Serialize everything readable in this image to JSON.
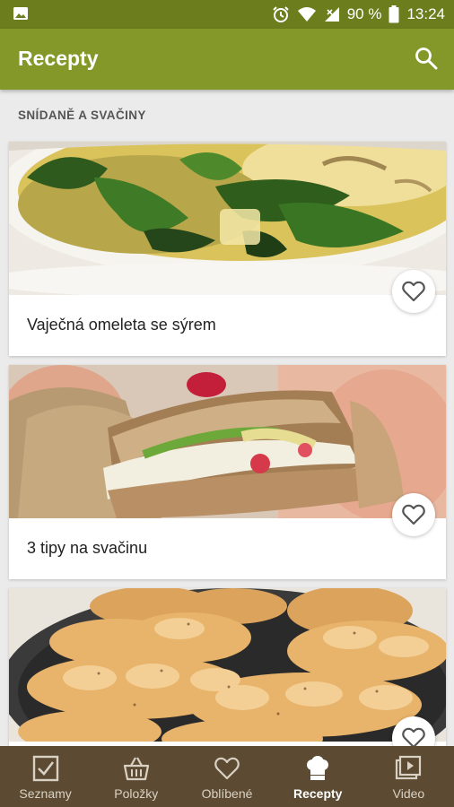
{
  "status_bar": {
    "battery": "90 %",
    "time": "13:24"
  },
  "app_bar": {
    "title": "Recepty"
  },
  "section": {
    "title": "SNÍDANĚ A SVAČINY"
  },
  "recipes": [
    {
      "title": "Vaječná omeleta se sýrem",
      "image": "omelette-spinach-photo"
    },
    {
      "title": "3 tipy na svačinu",
      "image": "sandwich-photo"
    },
    {
      "title": "",
      "image": "braided-bread-rolls-photo"
    }
  ],
  "bottom_nav": [
    {
      "label": "Seznamy",
      "icon": "checkbox-icon"
    },
    {
      "label": "Položky",
      "icon": "basket-icon"
    },
    {
      "label": "Oblíbené",
      "icon": "heart-icon"
    },
    {
      "label": "Recepty",
      "icon": "chef-hat-icon",
      "active": true
    },
    {
      "label": "Video",
      "icon": "video-icon"
    }
  ],
  "colors": {
    "status_bar": "#6b7d1c",
    "app_bar": "#84982a",
    "bottom_nav": "#5c4a32",
    "background": "#ebebeb"
  }
}
